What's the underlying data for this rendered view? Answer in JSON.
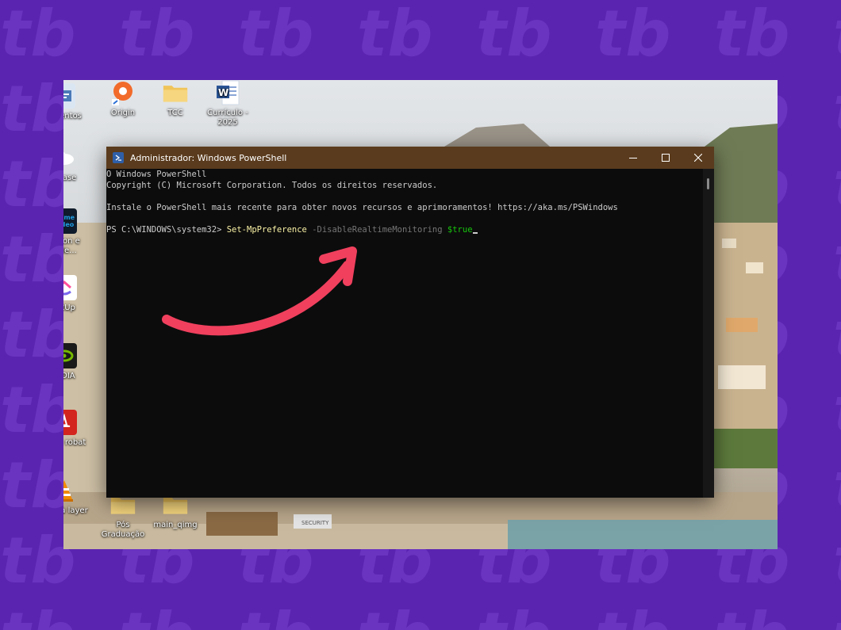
{
  "desktop_icons": [
    {
      "label": "umentos",
      "icon": "documents-icon",
      "color": "#4a7ab8"
    },
    {
      "label": "Origin",
      "icon": "origin-icon",
      "color": "#f26b2a"
    },
    {
      "label": "TCC",
      "icon": "folder-icon",
      "color": "#f0c45a"
    },
    {
      "label": "Currículo - 2025",
      "icon": "word-document-icon",
      "color": "#2b579a"
    },
    {
      "label": "nBase",
      "icon": "cloud-app-icon",
      "color": "#ffffff"
    },
    {
      "label": "nazon e Vide...",
      "icon": "prime-video-icon",
      "color": "#1f9ae0"
    },
    {
      "label": "ickUp",
      "icon": "clickup-icon",
      "color": "#7b68ee"
    },
    {
      "label": "VIDIA",
      "icon": "nvidia-icon",
      "color": "#76b900"
    },
    {
      "label": "dobe robat",
      "icon": "acrobat-icon",
      "color": "#d4241e"
    },
    {
      "label": "media layer",
      "icon": "vlc-icon",
      "color": "#f18a00"
    },
    {
      "label": "Pós Graduação",
      "icon": "folder-icon",
      "color": "#f0c45a"
    },
    {
      "label": "main_qimg",
      "icon": "folder-icon",
      "color": "#f0c45a"
    }
  ],
  "prime_text": "prime video",
  "window": {
    "title": "Administrador: Windows PowerShell",
    "icon": "powershell-icon"
  },
  "console": {
    "line1": "O Windows PowerShell",
    "line2": "Copyright (C) Microsoft Corporation. Todos os direitos reservados.",
    "line3": "Instale o PowerShell mais recente para obter novos recursos e aprimoramentos! https://aka.ms/PSWindows",
    "prompt": "PS C:\\WINDOWS\\system32> ",
    "command": "Set-MpPreference",
    "parameter": "-DisableRealtimeMonitoring",
    "value": "$true"
  },
  "colors": {
    "background": "#5b24b0",
    "titlebar": "#5a3b1d",
    "console_bg": "#0c0c0c",
    "cmdlet": "#f9f1a5",
    "parameter": "#767676",
    "variable": "#16c60c",
    "arrow": "#f0405e"
  }
}
